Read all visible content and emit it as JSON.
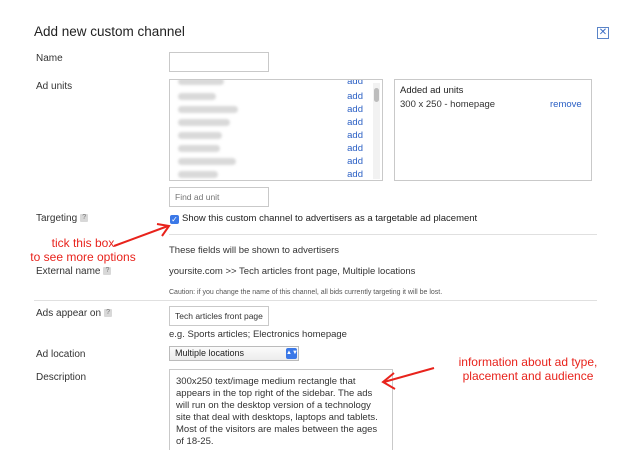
{
  "dialog": {
    "title": "Add new custom channel",
    "close_icon": "close-icon"
  },
  "name": {
    "label": "Name",
    "value": ""
  },
  "ad_units": {
    "label": "Ad units",
    "add_label": "add",
    "row_count": 8,
    "search_placeholder": "Find ad unit",
    "added": {
      "heading": "Added ad units",
      "items": [
        {
          "name": "300 x 250 - homepage",
          "remove_label": "remove"
        }
      ]
    }
  },
  "targeting": {
    "label": "Targeting",
    "help": "?",
    "checked": true,
    "checkbox_label": "Show this custom channel to advertisers as a targetable ad placement",
    "fields_note": "These fields will be shown to advertisers"
  },
  "external_name": {
    "label": "External name",
    "help": "?",
    "value": "yoursite.com >> Tech articles front page, Multiple locations",
    "caution": "Caution: if you change the name of this channel, all bids currently targeting it will be lost."
  },
  "ads_appear_on": {
    "label": "Ads appear on",
    "help": "?",
    "value": "Tech articles front page",
    "example": "e.g. Sports articles; Electronics homepage"
  },
  "ad_location": {
    "label": "Ad location",
    "selected": "Multiple locations"
  },
  "description": {
    "label": "Description",
    "value": "300x250 text/image medium rectangle that appears in the top right of the sidebar. The ads will run on the desktop version of a technology site that deal with desktops, laptops and tablets. Most of the visitors are males between the ages of 18-25."
  },
  "annotations": {
    "tick_line1": "tick this box",
    "tick_line2": "to see more options",
    "info_line1": "information about ad type,",
    "info_line2": "placement and audience",
    "color": "#e8231c"
  }
}
